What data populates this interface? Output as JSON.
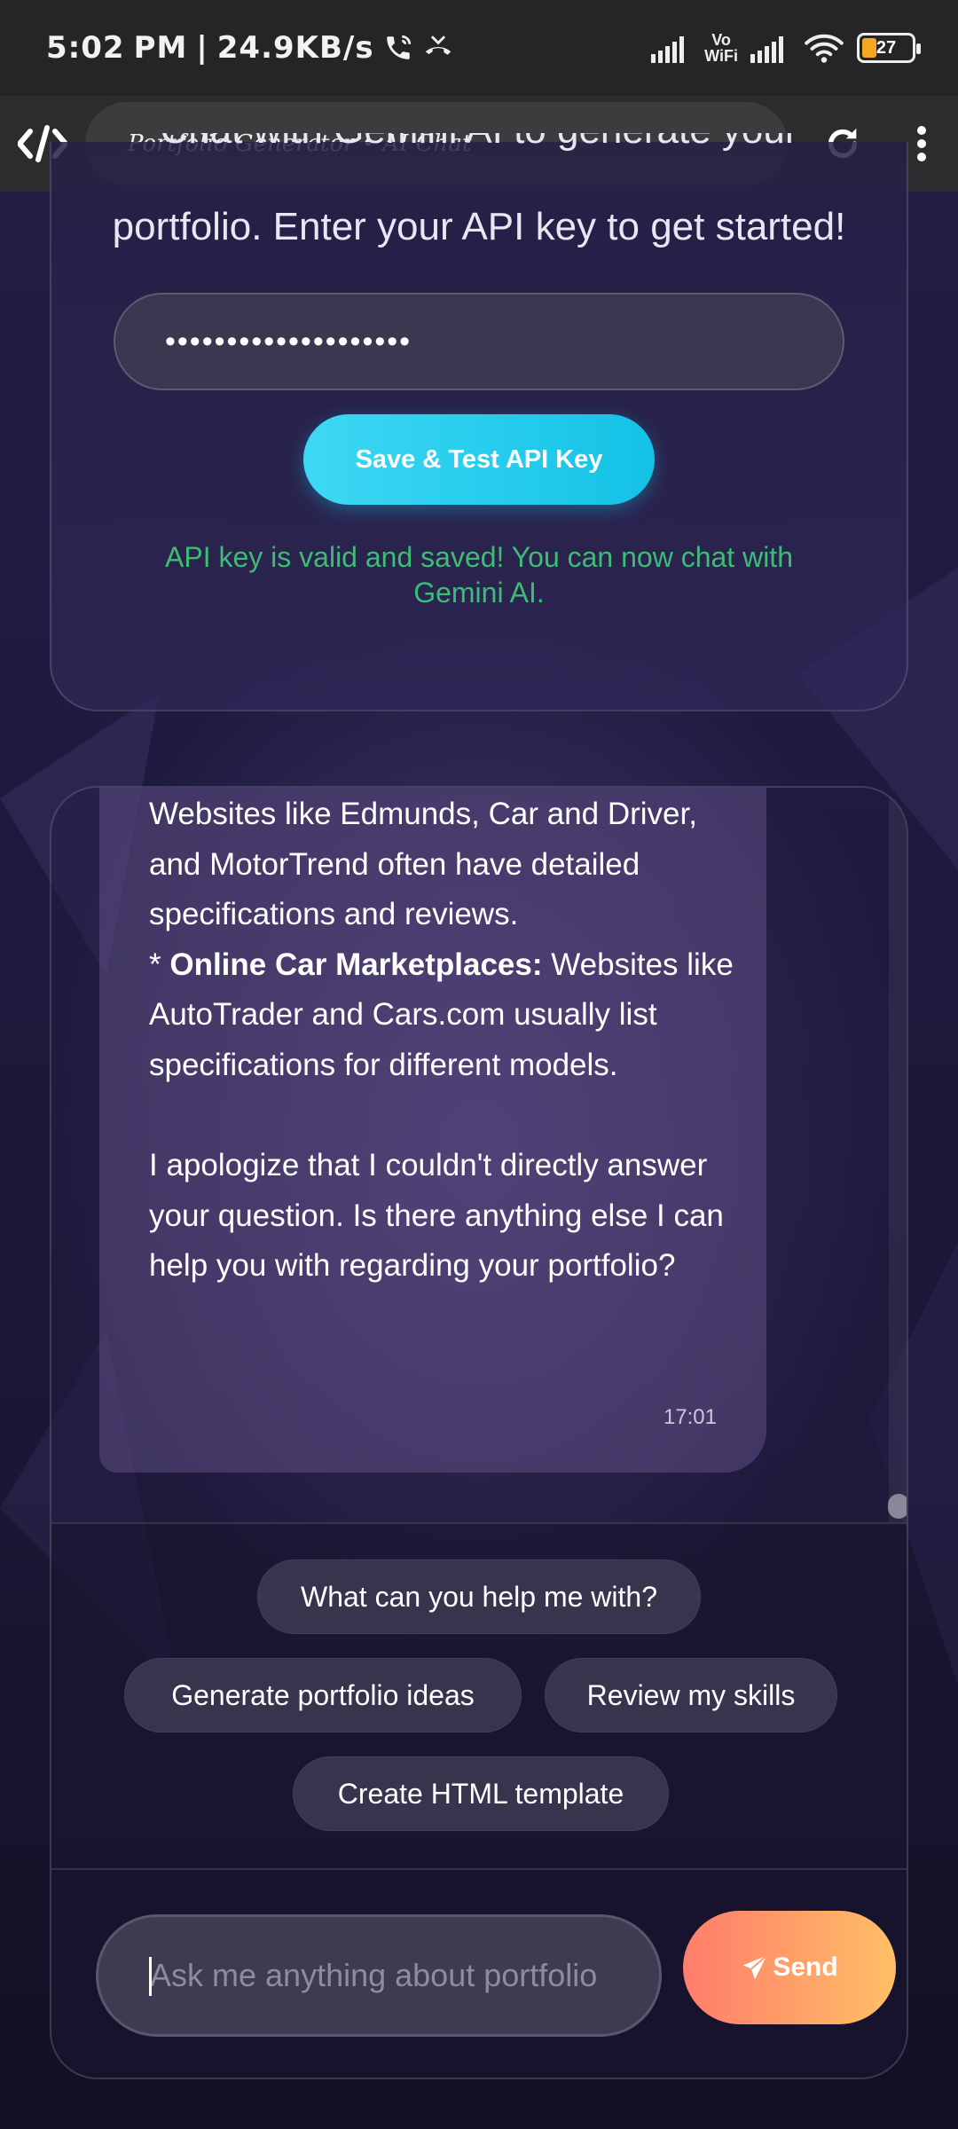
{
  "status_bar": {
    "time": "5:02",
    "ampm": "PM",
    "speed": "24.9KB/s",
    "vowifi_top": "Vo",
    "vowifi_bottom": "WiFi",
    "battery": "27"
  },
  "browser": {
    "page_title": "Portfolio Generator • AI Chat"
  },
  "api_section": {
    "intro_line1": "Chat with Gemini AI to generate your",
    "intro_line2": "portfolio. Enter your API key to get started!",
    "api_key_value": "••••••••••••••••••••",
    "save_button": "Save & Test API Key",
    "status_message": "API key is valid and saved! You can now chat with Gemini AI.",
    "status_color": "#3dbb77"
  },
  "chat": {
    "message": {
      "line_a": "Websites like Edmunds, Car and Driver, and MotorTrend often have detailed specifications and reviews.",
      "bullet_prefix": "* ",
      "bullet_bold": "Online Car Marketplaces:",
      "bullet_rest": " Websites like AutoTrader and Cars.com usually list specifications for different models.",
      "line_c": "I apologize that I couldn't directly answer your question. Is there anything else I can help you with regarding your portfolio?",
      "time": "17:01"
    },
    "suggestions": [
      "What can you help me with?",
      "Generate portfolio ideas",
      "Review my skills",
      "Create HTML template"
    ],
    "input_placeholder": "Ask me anything about portfolio",
    "send_label": "Send"
  },
  "colors": {
    "accent_cyan": "#14c2e6",
    "send_gradient_start": "#ff7c6b",
    "send_gradient_end": "#ffc066"
  }
}
